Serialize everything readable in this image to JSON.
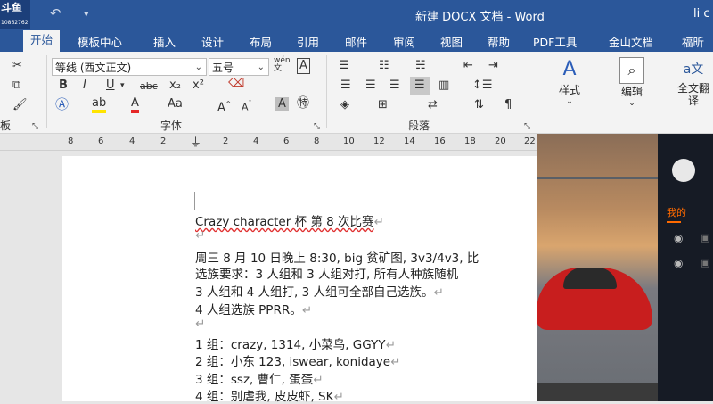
{
  "titlebar": {
    "logo_text": "斗鱼",
    "room_id": "10862762",
    "doc_title": "新建 DOCX 文档  -  Word",
    "user": "li c"
  },
  "tabs": [
    "开始",
    "模板中心",
    "插入",
    "设计",
    "布局",
    "引用",
    "邮件",
    "审阅",
    "视图",
    "帮助",
    "PDF工具",
    "金山文档",
    "福昕"
  ],
  "ribbon": {
    "font_name": "等线 (西文正文)",
    "font_size": "五号",
    "groups": {
      "clipboard": "板",
      "font": "字体",
      "paragraph": "段落"
    },
    "styles_label": "样式",
    "edit_label": "编辑",
    "translate_label": "全文翻译"
  },
  "ruler": [
    "8",
    "6",
    "4",
    "2",
    "2",
    "4",
    "6",
    "8",
    "10",
    "12",
    "14",
    "16",
    "18",
    "20",
    "22"
  ],
  "document": {
    "lines": [
      {
        "text": "Crazy character 杯  第 8 次比赛"
      },
      {
        "text": ""
      },
      {
        "text": "周三 8 月 10 日晚上 8:30,  big 贫矿图,  3v3/4v3,  比"
      },
      {
        "text": "选族要求：3 人组和 3 人组对打, 所有人种族随机"
      },
      {
        "text": "3 人组和 4 人组打, 3 人组可全部自己选族。"
      },
      {
        "text": "4 人组选族 PPRR。"
      },
      {
        "text": ""
      },
      {
        "text": "1 组：crazy,  1314,  小菜鸟,  GGYY"
      },
      {
        "text": "2 组：小东 123,  iswear,  konidaye"
      },
      {
        "text": "3 组：ssz,  曹仁,  蛋蛋"
      },
      {
        "text": "4 组：别虐我,  皮皮虾,  SK"
      }
    ]
  },
  "overlay": {
    "panel_text": "我的"
  }
}
